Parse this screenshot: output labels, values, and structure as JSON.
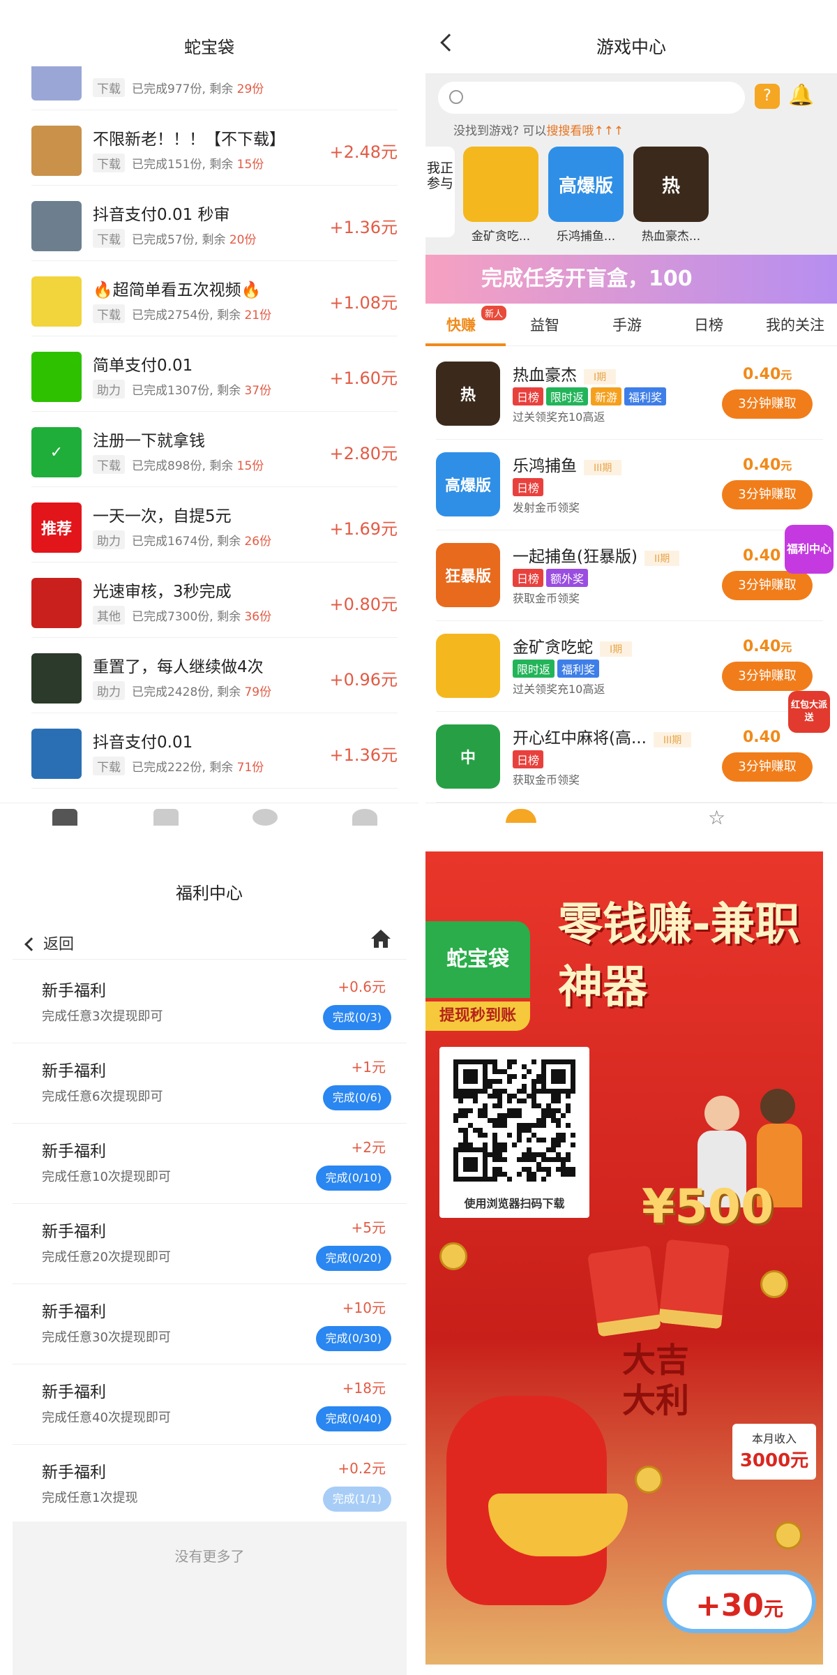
{
  "panel1": {
    "title": "蛇宝袋",
    "tasks": [
      {
        "title": "",
        "tag": "下载",
        "done": "已完成977份, 剩余 ",
        "remain": "29份",
        "reward": "",
        "thumb_color": "#9aa7d6",
        "thumb_text": ""
      },
      {
        "title": "不限新老！！！【不下载】",
        "tag": "下载",
        "done": "已完成151份, 剩余 ",
        "remain": "15份",
        "reward": "+2.48元",
        "thumb_color": "#c9914a",
        "thumb_text": ""
      },
      {
        "title": "抖音支付0.01 秒审",
        "tag": "下载",
        "done": "已完成57份, 剩余 ",
        "remain": "20份",
        "reward": "+1.36元",
        "thumb_color": "#6d7f8f",
        "thumb_text": ""
      },
      {
        "title": "🔥超简单看五次视频🔥",
        "tag": "下载",
        "done": "已完成2754份, 剩余 ",
        "remain": "21份",
        "reward": "+1.08元",
        "thumb_color": "#f2d43c",
        "thumb_text": ""
      },
      {
        "title": "简单支付0.01",
        "tag": "助力",
        "done": "已完成1307份, 剩余 ",
        "remain": "37份",
        "reward": "+1.60元",
        "thumb_color": "#2dc100",
        "thumb_text": ""
      },
      {
        "title": "注册一下就拿钱",
        "tag": "下载",
        "done": "已完成898份, 剩余 ",
        "remain": "15份",
        "reward": "+2.80元",
        "thumb_color": "#1fae3a",
        "thumb_text": "✓"
      },
      {
        "title": "一天一次，自提5元",
        "tag": "助力",
        "done": "已完成1674份, 剩余 ",
        "remain": "26份",
        "reward": "+1.69元",
        "thumb_color": "#e2151b",
        "thumb_text": "推荐"
      },
      {
        "title": "光速审核，3秒完成",
        "tag": "其他",
        "done": "已完成7300份, 剩余 ",
        "remain": "36份",
        "reward": "+0.80元",
        "thumb_color": "#c9201e",
        "thumb_text": ""
      },
      {
        "title": "重置了，每人继续做4次",
        "tag": "助力",
        "done": "已完成2428份, 剩余 ",
        "remain": "79份",
        "reward": "+0.96元",
        "thumb_color": "#2b3a2a",
        "thumb_text": ""
      },
      {
        "title": "抖音支付0.01",
        "tag": "下载",
        "done": "已完成222份, 剩余 ",
        "remain": "71份",
        "reward": "+1.36元",
        "thumb_color": "#2a6fb3",
        "thumb_text": ""
      }
    ]
  },
  "panel2": {
    "title": "游戏中心",
    "hint_prefix": "没找到游戏? 可以",
    "hint_link": "搜搜看哦",
    "side_tab": "我正参与",
    "recent_games": [
      {
        "name": "金矿贪吃...",
        "color": "#f4b71e",
        "text": ""
      },
      {
        "name": "乐鸿捕鱼...",
        "color": "#2f8fe6",
        "text": "高爆版"
      },
      {
        "name": "热血豪杰...",
        "color": "#3b2a1c",
        "text": "热"
      }
    ],
    "banner": "完成任务开盲盒，100",
    "tabs": [
      "快赚",
      "益智",
      "手游",
      "日榜",
      "我的关注"
    ],
    "new_badge": "新人",
    "games": [
      {
        "title": "热血豪杰",
        "phase": "I期",
        "tags": [
          {
            "t": "日榜",
            "c": "#e8413d"
          },
          {
            "t": "限时返",
            "c": "#23b45a"
          },
          {
            "t": "新游",
            "c": "#f5a01d"
          },
          {
            "t": "福利奖",
            "c": "#3e7ee8"
          }
        ],
        "desc": "过关领奖充10高返",
        "price": "0.40",
        "unit": "元",
        "btn": "3分钟赚取",
        "color": "#3b2a1c",
        "text": "热"
      },
      {
        "title": "乐鸿捕鱼",
        "phase": "III期",
        "tags": [
          {
            "t": "日榜",
            "c": "#e8413d"
          }
        ],
        "desc": "发射金币领奖",
        "price": "0.40",
        "unit": "元",
        "btn": "3分钟赚取",
        "color": "#2f8fe6",
        "text": "高爆版"
      },
      {
        "title": "一起捕鱼(狂暴版)",
        "phase": "II期",
        "tags": [
          {
            "t": "日榜",
            "c": "#e8413d"
          },
          {
            "t": "额外奖",
            "c": "#9a4de0"
          }
        ],
        "desc": "获取金币领奖",
        "price": "0.40",
        "unit": "",
        "btn": "3分钟赚取",
        "color": "#e86a1d",
        "text": "狂暴版"
      },
      {
        "title": "金矿贪吃蛇",
        "phase": "I期",
        "tags": [
          {
            "t": "限时返",
            "c": "#23b45a"
          },
          {
            "t": "福利奖",
            "c": "#3e7ee8"
          }
        ],
        "desc": "过关领奖充10高返",
        "price": "0.40",
        "unit": "元",
        "btn": "3分钟赚取",
        "color": "#f4b71e",
        "text": ""
      },
      {
        "title": "开心红中麻将(高...",
        "phase": "III期",
        "tags": [
          {
            "t": "日榜",
            "c": "#e8413d"
          }
        ],
        "desc": "获取金币领奖",
        "price": "0.40",
        "unit": "",
        "btn": "3分钟赚取",
        "color": "#27a045",
        "text": "中"
      }
    ],
    "float_welfare": "福利中心",
    "float_redpack": "红包大派送"
  },
  "panel3": {
    "title": "福利中心",
    "back": "返回",
    "items": [
      {
        "title": "新手福利",
        "desc": "完成任意3次提现即可",
        "reward": "+0.6元",
        "progress": "完成(0/3)",
        "done": false
      },
      {
        "title": "新手福利",
        "desc": "完成任意6次提现即可",
        "reward": "+1元",
        "progress": "完成(0/6)",
        "done": false
      },
      {
        "title": "新手福利",
        "desc": "完成任意10次提现即可",
        "reward": "+2元",
        "progress": "完成(0/10)",
        "done": false
      },
      {
        "title": "新手福利",
        "desc": "完成任意20次提现即可",
        "reward": "+5元",
        "progress": "完成(0/20)",
        "done": false
      },
      {
        "title": "新手福利",
        "desc": "完成任意30次提现即可",
        "reward": "+10元",
        "progress": "完成(0/30)",
        "done": false
      },
      {
        "title": "新手福利",
        "desc": "完成任意40次提现即可",
        "reward": "+18元",
        "progress": "完成(0/40)",
        "done": false
      },
      {
        "title": "新手福利",
        "desc": "完成任意1次提现",
        "reward": "+0.2元",
        "progress": "完成(1/1)",
        "done": true
      }
    ],
    "footer": "没有更多了"
  },
  "panel4": {
    "logo": "蛇宝袋",
    "sub": "提现秒到账",
    "headline": "零钱赚-兼职神器",
    "qr_caption": "使用浏览器扫码下载",
    "money": "¥500",
    "lucky": "大吉大利",
    "income_label": "本月收入",
    "income_value": "3000元",
    "bonus": "+30",
    "bonus_unit": "元"
  }
}
